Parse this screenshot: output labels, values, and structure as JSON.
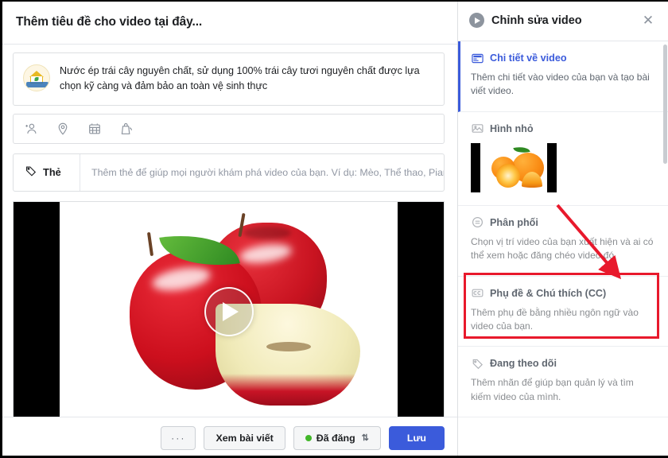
{
  "composer": {
    "title": "Thêm tiêu đề cho video tại đây...",
    "description": "Nước ép trái cây nguyên chất, sử dụng 100% trái cây tươi nguyên chất được lựa chọn kỹ càng và đảm bảo an toàn vệ sinh thực",
    "avatar_icon": "house-brand-logo",
    "toolbar_icons": [
      {
        "name": "tag-person-icon"
      },
      {
        "name": "location-pin-icon"
      },
      {
        "name": "calendar-icon"
      },
      {
        "name": "product-bag-icon"
      }
    ],
    "tag_row": {
      "icon": "tag-icon",
      "label": "Thẻ",
      "placeholder": "Thêm thẻ để giúp mọi người khám phá video của bạn. Ví dụ: Mèo, Thể thao, Pian"
    },
    "video": {
      "play_icon": "play-icon",
      "alt": "apples-video-preview"
    },
    "footer": {
      "more_label": "···",
      "view_post_label": "Xem bài viết",
      "status_label": "Đã đăng",
      "status_caret": "⇅",
      "status_dot_color": "#42b72a",
      "save_label": "Lưu",
      "save_color": "#3b5bdb"
    }
  },
  "edit_panel": {
    "header": {
      "icon": "play-circle-icon",
      "title": "Chỉnh sửa video",
      "close_label": "✕"
    },
    "sections": [
      {
        "id": "video-details",
        "icon": "video-details-icon",
        "label": "Chi tiết về video",
        "description": "Thêm chi tiết vào video của bạn và tạo bài viết video.",
        "active": true
      },
      {
        "id": "thumbnail",
        "icon": "image-icon",
        "label": "Hình nhỏ",
        "description": "",
        "active": false,
        "thumbnail_alt": "oranges-thumbnail"
      },
      {
        "id": "distribution",
        "icon": "distribution-icon",
        "label": "Phân phối",
        "description": "Chọn vị trí video của bạn xuất hiện và ai có thể xem hoặc đăng chéo video đó.",
        "active": false
      },
      {
        "id": "captions",
        "icon": "cc-icon",
        "label": "Phụ đề & Chú thích (CC)",
        "description": "Thêm phụ đề bằng nhiều ngôn ngữ vào video của bạn.",
        "active": false,
        "highlighted": true
      },
      {
        "id": "following",
        "icon": "tag-outline-icon",
        "label": "Đang theo dõi",
        "description": "Thêm nhãn để giúp bạn quản lý và tìm kiếm video của mình.",
        "active": false
      }
    ]
  },
  "annotations": {
    "arrow_color": "#e8192c",
    "box_color": "#e8192c",
    "arrow_name": "red-annotation-arrow",
    "box_name": "red-annotation-box"
  }
}
